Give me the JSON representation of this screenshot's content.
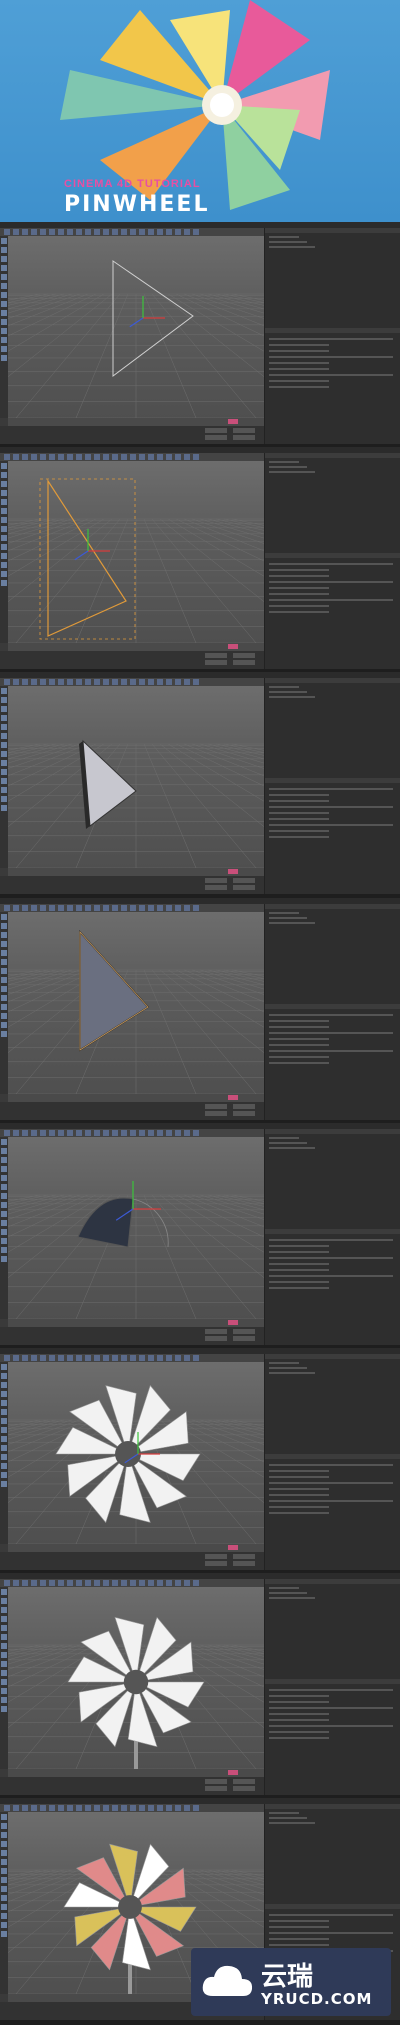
{
  "hero": {
    "subtitle": "CINEMA 4D TUTORIAL",
    "title": "PINWHEEL"
  },
  "watermark": {
    "chinese": "云瑞",
    "domain": "YRUCD.COM"
  },
  "steps": [
    {
      "stage": "triangle-outline"
    },
    {
      "stage": "triangle-outline-selected"
    },
    {
      "stage": "extruded-triangle"
    },
    {
      "stage": "textured-triangle"
    },
    {
      "stage": "bent-blade"
    },
    {
      "stage": "pinwheel-white"
    },
    {
      "stage": "pinwheel-with-stick"
    },
    {
      "stage": "pinwheel-colored"
    }
  ],
  "colors": {
    "hero_sky": "#3e90cc",
    "ui_background": "#3a3a3a",
    "viewport": "#5e5e5e",
    "accent_record": "#c94f7a",
    "axis_x": "#d63c3c",
    "axis_y": "#3cc43c",
    "axis_z": "#3c5ad6",
    "selection_orange": "#e09a3a"
  }
}
